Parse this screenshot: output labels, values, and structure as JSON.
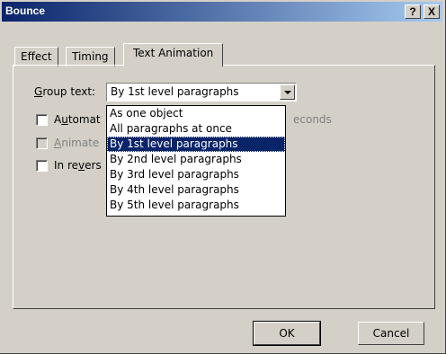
{
  "window": {
    "title": "Bounce",
    "help_label": "?",
    "close_label": "X"
  },
  "tabs": [
    {
      "label": "Effect"
    },
    {
      "label": "Timing"
    },
    {
      "label": "Text Animation",
      "active": true
    }
  ],
  "group_text": {
    "label_first": "G",
    "label_rest": "roup text:",
    "selected": "By 1st level paragraphs",
    "options": [
      "As one object",
      "All paragraphs at once",
      "By 1st level paragraphs",
      "By 2nd level paragraphs",
      "By 3rd level paragraphs",
      "By 4th level paragraphs",
      "By 5th level paragraphs"
    ],
    "selected_index": 2
  },
  "options": {
    "automatically": {
      "pre": "A",
      "key": "u",
      "post": "tomat",
      "checked": false
    },
    "seconds_label": "econds",
    "animate": {
      "pre": "",
      "key": "A",
      "post": "nimate",
      "checked": false,
      "disabled": true
    },
    "reverse": {
      "pre": "In re",
      "key": "v",
      "post": "ers",
      "checked": false
    }
  },
  "buttons": {
    "ok": "OK",
    "cancel": "Cancel"
  }
}
